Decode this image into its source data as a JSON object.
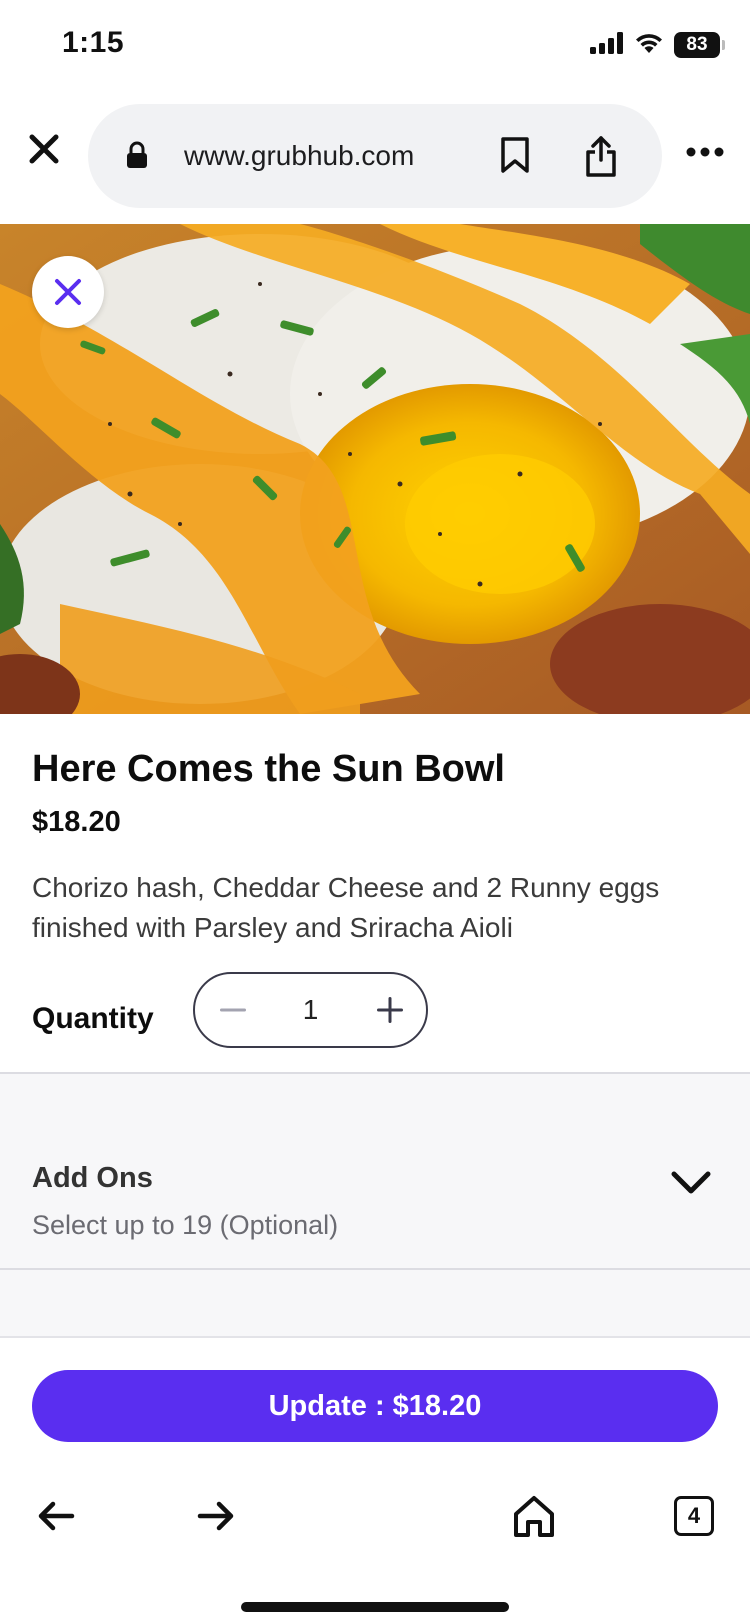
{
  "status_bar": {
    "time": "1:15",
    "battery": "83",
    "icons": [
      "cellular-signal-icon",
      "wifi-icon",
      "battery-icon"
    ]
  },
  "browser": {
    "url": "www.grubhub.com",
    "icons": [
      "close-icon",
      "lock-icon",
      "bookmark-icon",
      "share-icon",
      "more-icon"
    ]
  },
  "item": {
    "title": "Here Comes the Sun Bowl",
    "price": "$18.20",
    "description": "Chorizo hash, Cheddar Cheese and 2 Runny eggs finished with Parsley and Sriracha Aioli",
    "quantity_label": "Quantity",
    "quantity": "1"
  },
  "addons": {
    "title": "Add Ons",
    "subtitle": "Select up to 19 (Optional)"
  },
  "cta": {
    "label": "Update : $18.20"
  },
  "toolbar": {
    "tab_count": "4"
  },
  "colors": {
    "brand_accent": "#5a2ef0",
    "close_x": "#5a2ef0"
  }
}
